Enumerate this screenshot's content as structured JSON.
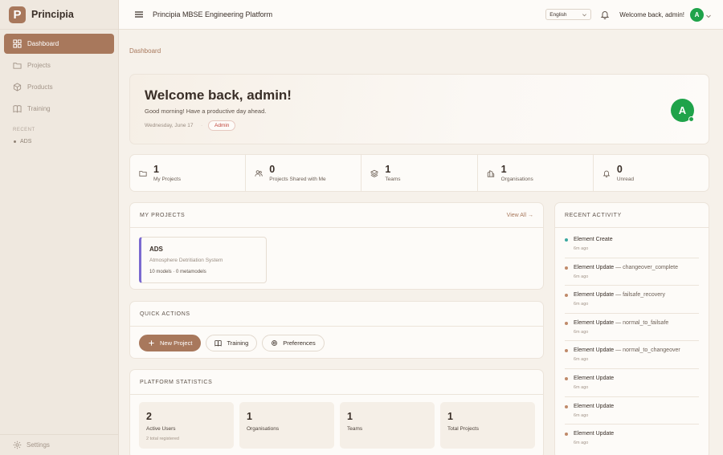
{
  "brand": {
    "logo_letter": "P",
    "name": "Principia"
  },
  "sidebar": {
    "items": [
      {
        "label": "Dashboard",
        "icon": "dashboard-icon",
        "active": true
      },
      {
        "label": "Projects",
        "icon": "folder-icon",
        "active": false
      },
      {
        "label": "Products",
        "icon": "box-icon",
        "active": false
      },
      {
        "label": "Training",
        "icon": "book-icon",
        "active": false
      }
    ],
    "recent_label": "RECENT",
    "recent_items": [
      "ADS"
    ],
    "settings_label": "Settings"
  },
  "header": {
    "title": "Principia MBSE Engineering Platform",
    "language": "English",
    "welcome": "Welcome back, admin!",
    "avatar_letter": "A"
  },
  "breadcrumb": "Dashboard",
  "hero": {
    "title": "Welcome back, admin!",
    "subtitle": "Good morning! Have a productive day ahead.",
    "date": "Wednesday, June 17",
    "separator": "·",
    "role": "Admin",
    "avatar_letter": "A"
  },
  "stats": [
    {
      "value": "1",
      "label": "My Projects",
      "icon": "folder-icon"
    },
    {
      "value": "0",
      "label": "Projects Shared with Me",
      "icon": "users-icon"
    },
    {
      "value": "1",
      "label": "Teams",
      "icon": "layers-icon"
    },
    {
      "value": "1",
      "label": "Organisations",
      "icon": "building-icon"
    },
    {
      "value": "0",
      "label": "Unread",
      "icon": "bell-icon"
    }
  ],
  "projects": {
    "title": "MY PROJECTS",
    "view_all": "View All →",
    "items": [
      {
        "name": "ADS",
        "description": "Atmosphere Detritiation System",
        "meta": "10 models · 0 metamodels"
      }
    ]
  },
  "quick_actions": {
    "title": "QUICK ACTIONS",
    "buttons": [
      {
        "label": "New Project",
        "icon": "plus-icon"
      },
      {
        "label": "Training",
        "icon": "book-icon"
      },
      {
        "label": "Preferences",
        "icon": "gear-icon"
      }
    ]
  },
  "platform_stats": {
    "title": "PLATFORM STATISTICS",
    "items": [
      {
        "value": "2",
        "label": "Active Users",
        "sub": "2 total registered"
      },
      {
        "value": "1",
        "label": "Organisations",
        "sub": ""
      },
      {
        "value": "1",
        "label": "Teams",
        "sub": ""
      },
      {
        "value": "1",
        "label": "Total Projects",
        "sub": ""
      }
    ]
  },
  "activity": {
    "title": "RECENT ACTIVITY",
    "items": [
      {
        "title": "Element Create",
        "detail": "",
        "time": "6m ago"
      },
      {
        "title": "Element Update",
        "detail": " — changeover_complete",
        "time": "6m ago"
      },
      {
        "title": "Element Update",
        "detail": " — failsafe_recovery",
        "time": "6m ago"
      },
      {
        "title": "Element Update",
        "detail": " — normal_to_failsafe",
        "time": "6m ago"
      },
      {
        "title": "Element Update",
        "detail": " — normal_to_changeover",
        "time": "6m ago"
      },
      {
        "title": "Element Update",
        "detail": "",
        "time": "6m ago"
      },
      {
        "title": "Element Update",
        "detail": "",
        "time": "6m ago"
      },
      {
        "title": "Element Update",
        "detail": "",
        "time": "6m ago"
      }
    ]
  },
  "colors": {
    "accent": "#a8785c",
    "avatar": "#1fa34a",
    "project_accent": "#7b6ad0"
  }
}
